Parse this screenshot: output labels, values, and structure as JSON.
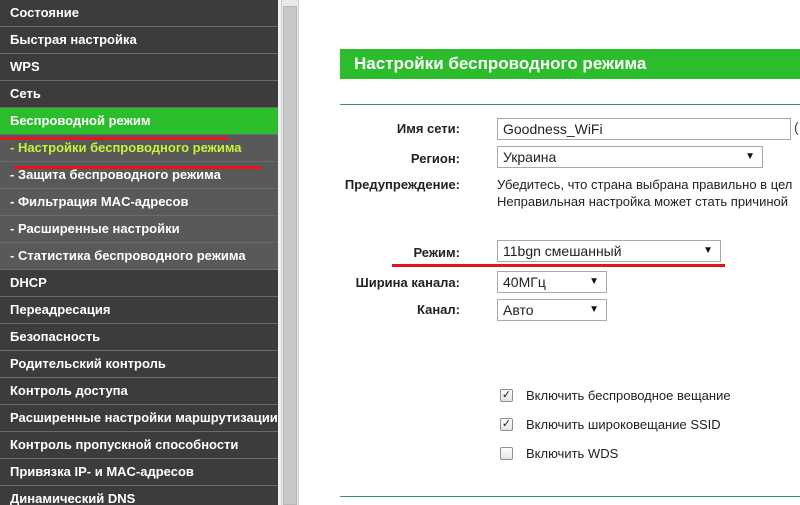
{
  "sidebar": {
    "items": [
      {
        "label": "Состояние",
        "type": "main"
      },
      {
        "label": "Быстрая настройка",
        "type": "main"
      },
      {
        "label": "WPS",
        "type": "main"
      },
      {
        "label": "Сеть",
        "type": "main"
      },
      {
        "label": "Беспроводной режим",
        "type": "active"
      },
      {
        "label": "- Настройки беспроводного режима",
        "type": "sub-current"
      },
      {
        "label": "- Защита беспроводного режима",
        "type": "sub"
      },
      {
        "label": "- Фильтрация MAC-адресов",
        "type": "sub"
      },
      {
        "label": "- Расширенные настройки",
        "type": "sub"
      },
      {
        "label": "- Статистика беспроводного режима",
        "type": "sub"
      },
      {
        "label": "DHCP",
        "type": "main"
      },
      {
        "label": "Переадресация",
        "type": "main"
      },
      {
        "label": "Безопасность",
        "type": "main"
      },
      {
        "label": "Родительский контроль",
        "type": "main"
      },
      {
        "label": "Контроль доступа",
        "type": "main"
      },
      {
        "label": "Расширенные настройки маршрутизации",
        "type": "main"
      },
      {
        "label": "Контроль пропускной способности",
        "type": "main"
      },
      {
        "label": "Привязка IP- и MAC-адресов",
        "type": "main"
      },
      {
        "label": "Динамический DNS",
        "type": "main"
      }
    ]
  },
  "main": {
    "title": "Настройки беспроводного режима",
    "network_name": {
      "label": "Имя сети:",
      "value": "Goodness_WiFi",
      "tail": "("
    },
    "region": {
      "label": "Регион:",
      "value": "Украина"
    },
    "warning": {
      "label": "Предупреждение:",
      "line1": "Убедитесь, что страна выбрана правильно в цел",
      "line2": "Неправильная настройка может стать причиной"
    },
    "mode": {
      "label": "Режим:",
      "value": "11bgn смешанный"
    },
    "channel_width": {
      "label": "Ширина канала:",
      "value": "40МГц"
    },
    "channel": {
      "label": "Канал:",
      "value": "Авто"
    },
    "checkboxes": [
      {
        "label": "Включить беспроводное вещание",
        "checked": true
      },
      {
        "label": "Включить широковещание SSID",
        "checked": true
      },
      {
        "label": "Включить WDS",
        "checked": false
      }
    ]
  },
  "colors": {
    "accent_green": "#2bbd2b",
    "sidebar_dark": "#3c3c3c",
    "sidebar_sub": "#595959",
    "current_sub_text": "#c6f23a",
    "annotation_red": "#e8141c"
  }
}
